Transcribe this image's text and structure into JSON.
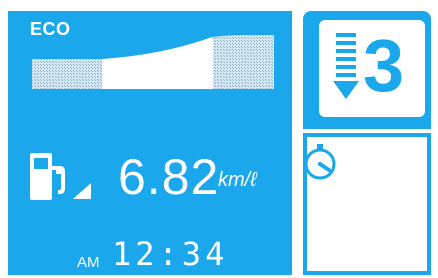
{
  "eco": {
    "label": "ECO",
    "level": 0.85
  },
  "fuel_economy": {
    "value": "6.82",
    "unit": "km/ℓ"
  },
  "clock": {
    "ampm": "AM",
    "time": "12:34"
  },
  "gear": {
    "number": "3"
  },
  "colors": {
    "accent": "#1aa7eb",
    "foreground": "#ffffff"
  },
  "icons": {
    "fuel": "fuel-pump-icon",
    "arrow": "arrow-down-right-icon",
    "gear": "downshift-indicator-icon",
    "trip": "stopwatch-icon"
  }
}
